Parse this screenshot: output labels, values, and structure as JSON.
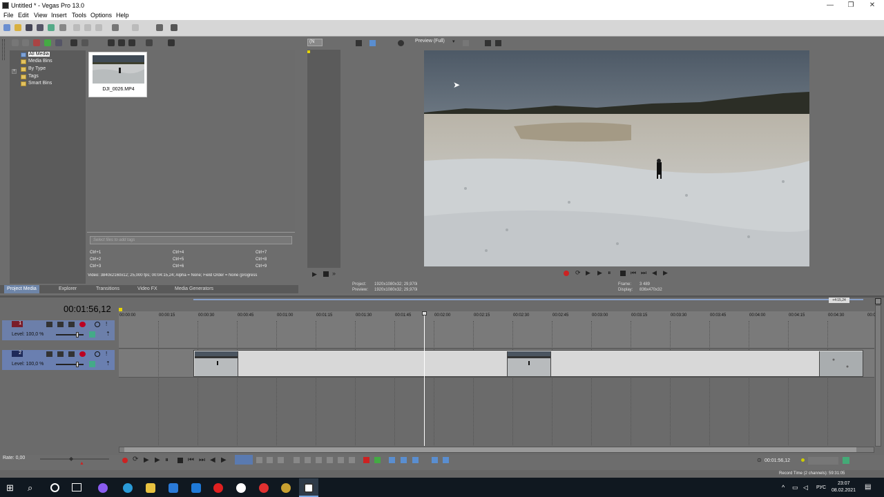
{
  "window": {
    "title": "Untitled * - Vegas Pro 13.0",
    "minimize": "—",
    "restore": "❐",
    "close": "✕"
  },
  "menu": [
    "File",
    "Edit",
    "View",
    "Insert",
    "Tools",
    "Options",
    "Help"
  ],
  "explorer": {
    "tree": [
      {
        "label": "All Media"
      },
      {
        "label": "Media Bins"
      },
      {
        "label": "By Type"
      },
      {
        "label": "Tags"
      },
      {
        "label": "Smart Bins"
      }
    ],
    "tree_expand": "+",
    "media_item": {
      "filename": "DJI_0026.MP4"
    },
    "tag_placeholder": "Select files to add tags",
    "shortcuts": [
      "Ctrl+1",
      "Ctrl+2",
      "Ctrl+3",
      "Ctrl+4",
      "Ctrl+5",
      "Ctrl+6",
      "Ctrl+7",
      "Ctrl+8",
      "Ctrl+9"
    ],
    "file_info": "Video: 3840x2160x12; 25,000 fps; 00:04:15,24; Alpha = None; Field Order = None (progress"
  },
  "tabs": [
    "Project Media",
    "Explorer",
    "Transitions",
    "Video FX",
    "Media Generators"
  ],
  "trimmer": {
    "dropdown": "(N"
  },
  "preview": {
    "mode": "Preview (Full)",
    "project_label": "Project:",
    "project_value": "1920x1080x32; 29,970i",
    "preview_label": "Preview:",
    "preview_value": "1920x1080x32; 29,970i",
    "frame_label": "Frame:",
    "frame_value": "3 489",
    "display_label": "Display:",
    "display_value": "836x470x32"
  },
  "timeline": {
    "current_time": "00:01:56,12",
    "end_marker": "+4:15,24",
    "ruler": [
      "00:00:00",
      "00:00:15",
      "00:00:30",
      "00:00:45",
      "00:01:00",
      "00:01:15",
      "00:01:30",
      "00:01:45",
      "00:02:00",
      "00:02:15",
      "00:02:30",
      "00:02:45",
      "00:03:00",
      "00:03:15",
      "00:03:30",
      "00:03:45",
      "00:04:00",
      "00:04:15",
      "00:04:30",
      "00:0"
    ],
    "tracks": [
      {
        "number": "1",
        "level": "Level: 100,0 %"
      },
      {
        "number": "2",
        "level": "Level: 100,0 %"
      }
    ]
  },
  "bottom": {
    "rate": "Rate: 0,00",
    "cursor_time": "00:01:56,12",
    "record_time": "Record Time (2 channels): 59:31:05"
  },
  "taskbar": {
    "lang": "РУС",
    "time": "23:07",
    "date": "08.02.2021"
  }
}
